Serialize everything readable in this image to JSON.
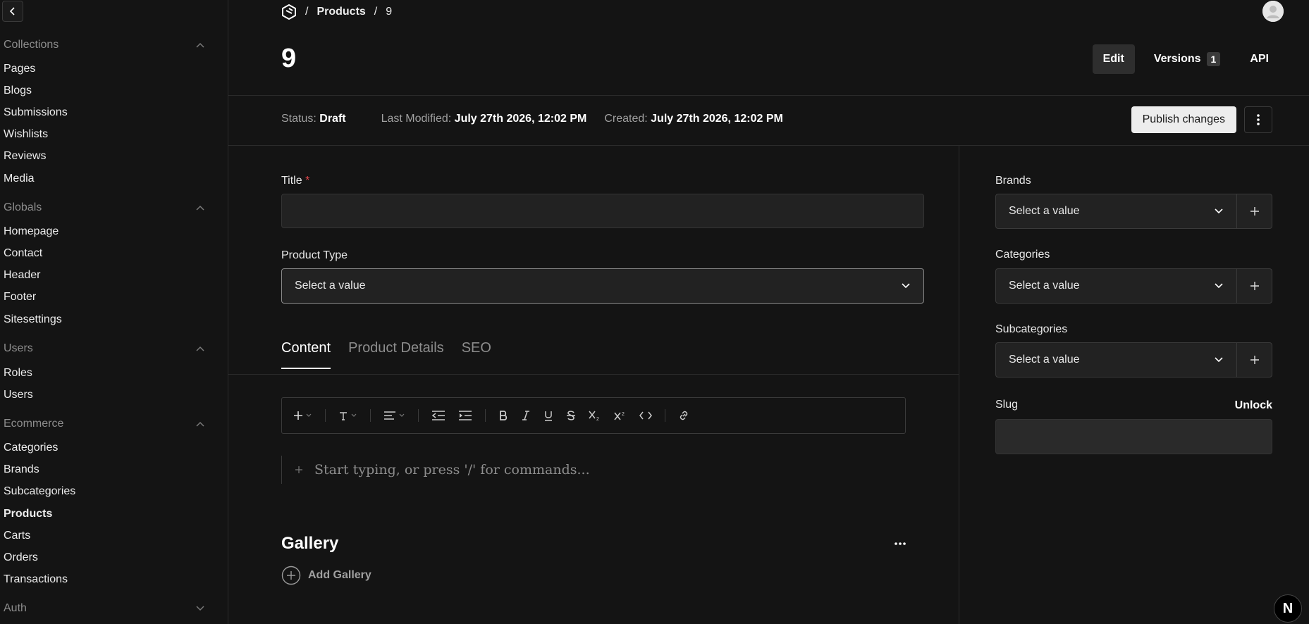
{
  "sidebar": {
    "groups": [
      {
        "label": "Collections",
        "items": [
          "Pages",
          "Blogs",
          "Submissions",
          "Wishlists",
          "Reviews",
          "Media"
        ]
      },
      {
        "label": "Globals",
        "items": [
          "Homepage",
          "Contact",
          "Header",
          "Footer",
          "Sitesettings"
        ]
      },
      {
        "label": "Users",
        "items": [
          "Roles",
          "Users"
        ]
      },
      {
        "label": "Ecommerce",
        "items": [
          "Categories",
          "Brands",
          "Subcategories",
          "Products",
          "Carts",
          "Orders",
          "Transactions"
        ]
      },
      {
        "label": "Auth",
        "items": []
      }
    ],
    "active_item": "Products"
  },
  "breadcrumb": {
    "collection": "Products",
    "doc_id": "9"
  },
  "document": {
    "title": "9"
  },
  "top_actions": {
    "edit": "Edit",
    "versions": "Versions",
    "versions_count": "1",
    "api": "API"
  },
  "status": {
    "status_label": "Status:",
    "status_value": "Draft",
    "modified_label": "Last Modified:",
    "modified_value": "July 27th 2026, 12:02 PM",
    "created_label": "Created:",
    "created_value": "July 27th 2026, 12:02 PM"
  },
  "publish": {
    "label": "Publish changes"
  },
  "form": {
    "title_label": "Title",
    "required_mark": "*",
    "product_type_label": "Product Type",
    "product_type_value": "Select a value"
  },
  "tabs": [
    "Content",
    "Product Details",
    "SEO"
  ],
  "editor": {
    "placeholder": "Start typing, or press '/' for commands..."
  },
  "gallery": {
    "title": "Gallery",
    "add_label": "Add Gallery"
  },
  "right_panel": {
    "brands_label": "Brands",
    "brands_value": "Select a value",
    "categories_label": "Categories",
    "categories_value": "Select a value",
    "subcategories_label": "Subcategories",
    "subcategories_value": "Select a value",
    "slug_label": "Slug",
    "unlock_label": "Unlock"
  },
  "badge": {
    "letter": "N"
  }
}
